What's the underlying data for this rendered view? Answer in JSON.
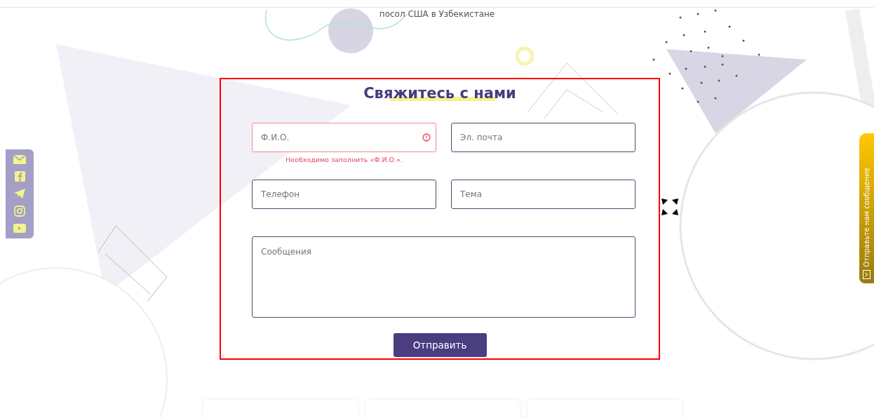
{
  "top_caption": "посол США в Узбекистане",
  "form": {
    "title": "Свяжитесь с нами",
    "fields": [
      {
        "kind": "input",
        "placeholder": "Ф.И.О.",
        "invalid": true,
        "error": "Необходимо заполнить «Ф.И.О.»."
      },
      {
        "kind": "input",
        "placeholder": "Эл. почта",
        "invalid": false
      },
      {
        "kind": "input",
        "placeholder": "Телефон",
        "invalid": false
      },
      {
        "kind": "input",
        "placeholder": "Тема",
        "invalid": false
      },
      {
        "kind": "textarea",
        "placeholder": "Сообщения",
        "invalid": false
      }
    ],
    "submit": "Отправить"
  },
  "social": [
    {
      "kind": "mail"
    },
    {
      "kind": "facebook"
    },
    {
      "kind": "telegram"
    },
    {
      "kind": "instagram"
    },
    {
      "kind": "youtube"
    }
  ],
  "side_tab": {
    "label": "Отправьте нам сообщение"
  }
}
